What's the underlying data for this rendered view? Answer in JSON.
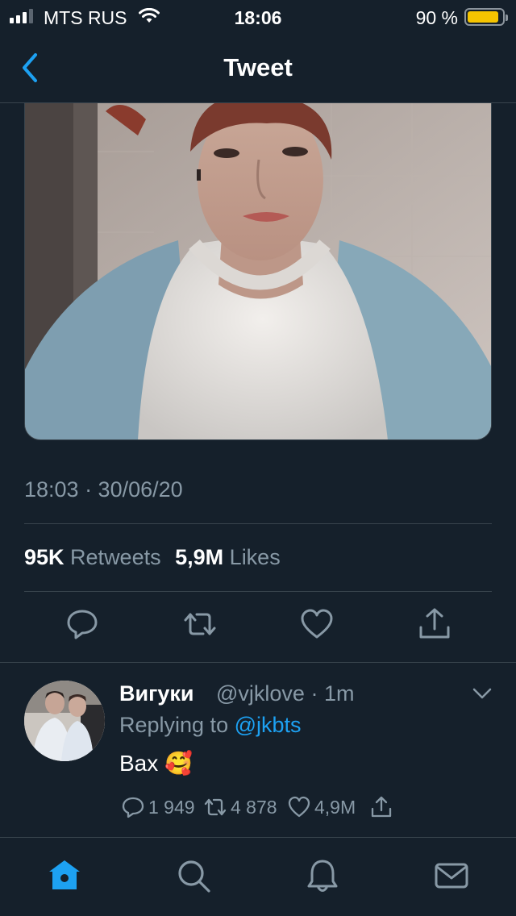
{
  "status_bar": {
    "carrier": "MTS RUS",
    "time": "18:06",
    "battery_percent": "90 %",
    "battery_level": 0.9,
    "signal_bars_filled": 3,
    "signal_bars_total": 4,
    "icons": [
      "signal-icon",
      "wifi-icon",
      "battery-icon"
    ]
  },
  "nav": {
    "title": "Tweet",
    "back_icon": "chevron-left-icon"
  },
  "tweet": {
    "timestamp": "18:03 · 30/06/20",
    "retweets_count": "95K",
    "retweets_label": "Retweets",
    "likes_count": "5,9M",
    "likes_label": "Likes",
    "actions": [
      "reply-icon",
      "retweet-icon",
      "like-icon",
      "share-icon"
    ]
  },
  "reply": {
    "name": "Вигуки",
    "handle": "@vjklove",
    "separator": "·",
    "age": "1m",
    "replying_prefix": "Replying to",
    "replying_handle": "@jkbts",
    "text": "Вах 🥰",
    "reply_count": "1 949",
    "retweet_count": "4 878",
    "like_count": "4,9M"
  },
  "tabbar": {
    "tabs": [
      "home-icon",
      "search-icon",
      "notifications-icon",
      "messages-icon"
    ],
    "active": "home-icon"
  },
  "colors": {
    "background": "#15202b",
    "divider": "#38444d",
    "secondary_text": "#8899a6",
    "accent": "#1da1f2",
    "battery": "#f5c400"
  }
}
